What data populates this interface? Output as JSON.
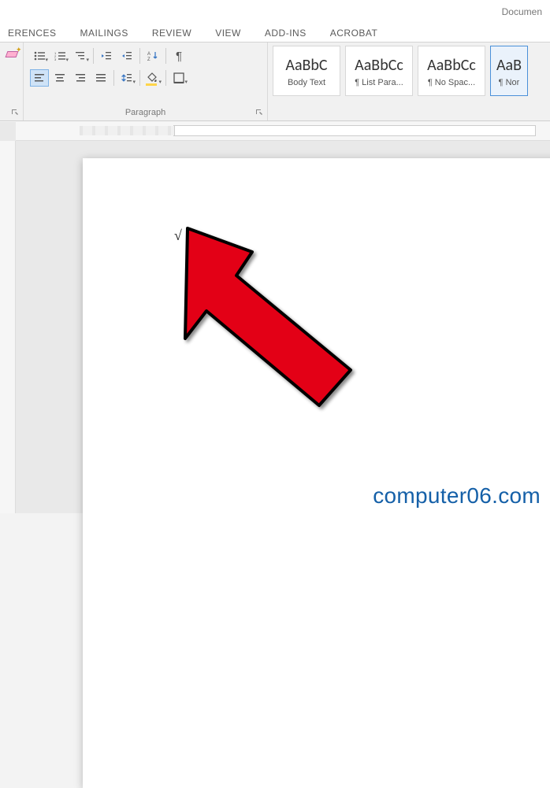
{
  "title": "Documen",
  "tabs": [
    "ERENCES",
    "MAILINGS",
    "REVIEW",
    "VIEW",
    "ADD-INS",
    "ACROBAT"
  ],
  "paragraph": {
    "label": "Paragraph"
  },
  "styles": {
    "label": "",
    "items": [
      {
        "preview": "AaBbC",
        "name": "Body Text"
      },
      {
        "preview": "AaBbCc",
        "name": "¶ List Para..."
      },
      {
        "preview": "AaBbCc",
        "name": "¶ No Spac..."
      },
      {
        "preview": "AaB",
        "name": "¶ Nor"
      }
    ]
  },
  "document": {
    "content": "√"
  },
  "watermark": "computer06.com"
}
